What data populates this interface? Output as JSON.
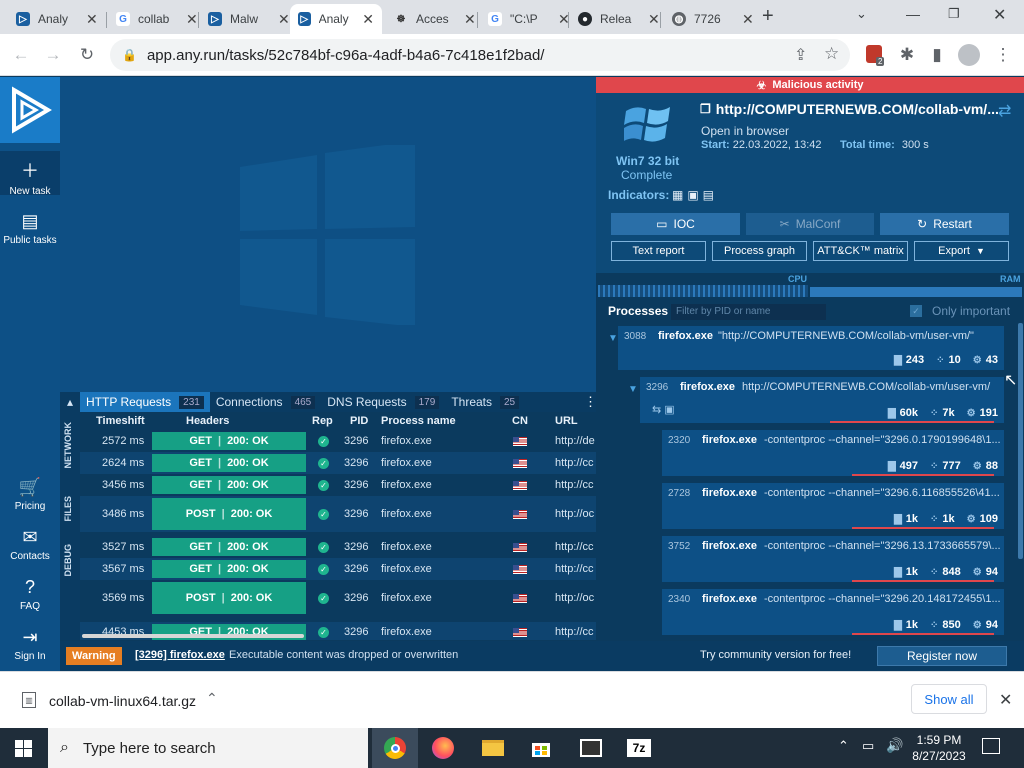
{
  "browser": {
    "tabs": [
      {
        "label": "Analy",
        "icon": "anyrun-icon",
        "active": false
      },
      {
        "label": "collab",
        "icon": "google-icon",
        "active": false
      },
      {
        "label": "Malw",
        "icon": "anyrun-icon",
        "active": false
      },
      {
        "label": "Analy",
        "icon": "anyrun-icon",
        "active": true
      },
      {
        "label": "Acces",
        "icon": "unknown-icon",
        "active": false
      },
      {
        "label": "\"C:\\P",
        "icon": "google-icon",
        "active": false
      },
      {
        "label": "Relea",
        "icon": "github-icon",
        "active": false
      },
      {
        "label": "7726",
        "icon": "globe-icon",
        "active": false
      }
    ],
    "url": "app.any.run/tasks/52c784bf-c96a-4adf-b4a6-7c418e1f2bad/",
    "extension_badge": "2"
  },
  "nav": {
    "new_task": "New task",
    "public_tasks": "Public tasks",
    "pricing": "Pricing",
    "contacts": "Contacts",
    "faq": "FAQ",
    "sign_in": "Sign In"
  },
  "network": {
    "tabs": [
      {
        "label": "HTTP Requests",
        "count": "231"
      },
      {
        "label": "Connections",
        "count": "465"
      },
      {
        "label": "DNS Requests",
        "count": "179"
      },
      {
        "label": "Threats",
        "count": "25"
      }
    ],
    "side_labels": [
      "NETWORK",
      "FILES",
      "DEBUG"
    ],
    "columns": {
      "timeshift": "Timeshift",
      "headers": "Headers",
      "rep": "Rep",
      "pid": "PID",
      "process": "Process name",
      "cn": "CN",
      "url": "URL"
    },
    "rows": [
      {
        "time": "2572 ms",
        "method": "GET",
        "status": "200: OK",
        "pid": "3296",
        "process": "firefox.exe",
        "url": "http://de"
      },
      {
        "time": "2624 ms",
        "method": "GET",
        "status": "200: OK",
        "pid": "3296",
        "process": "firefox.exe",
        "url": "http://cc"
      },
      {
        "time": "3456 ms",
        "method": "GET",
        "status": "200: OK",
        "pid": "3296",
        "process": "firefox.exe",
        "url": "http://cc"
      },
      {
        "time": "3486 ms",
        "method": "POST",
        "status": "200: OK",
        "pid": "3296",
        "process": "firefox.exe",
        "url": "http://oc"
      },
      {
        "time": "3527 ms",
        "method": "GET",
        "status": "200: OK",
        "pid": "3296",
        "process": "firefox.exe",
        "url": "http://cc"
      },
      {
        "time": "3567 ms",
        "method": "GET",
        "status": "200: OK",
        "pid": "3296",
        "process": "firefox.exe",
        "url": "http://cc"
      },
      {
        "time": "3569 ms",
        "method": "POST",
        "status": "200: OK",
        "pid": "3296",
        "process": "firefox.exe",
        "url": "http://oc"
      },
      {
        "time": "4453 ms",
        "method": "GET",
        "status": "200: OK",
        "pid": "3296",
        "process": "firefox.exe",
        "url": "http://cc"
      }
    ]
  },
  "task": {
    "malicious": "Malicious activity",
    "url": "http://COMPUTERNEWB.COM/collab-vm/...",
    "os": "Win7 32 bit",
    "state": "Complete",
    "open_in": "Open in browser",
    "start_label": "Start:",
    "start_value": "22.03.2022, 13:42",
    "total_label": "Total time:",
    "total_value": "300 s",
    "indicators": "Indicators:",
    "ioc": "IOC",
    "malconf": "MalConf",
    "restart": "Restart",
    "text_report": "Text report",
    "process_graph": "Process graph",
    "attck": "ATT&CK™ matrix",
    "export": "Export",
    "cpu": "CPU",
    "ram": "RAM"
  },
  "processes": {
    "title": "Processes",
    "filter_placeholder": "Filter by PID or name",
    "only_important": "Only important",
    "items": [
      {
        "pid": "3088",
        "name": "firefox.exe",
        "cmd": "\"http://COMPUTERNEWB.COM/collab-vm/user-vm/\"",
        "s1": "243",
        "s2": "10",
        "s3": "43"
      },
      {
        "pid": "3296",
        "name": "firefox.exe",
        "cmd": "http://COMPUTERNEWB.COM/collab-vm/user-vm/",
        "s1": "60k",
        "s2": "7k",
        "s3": "191"
      },
      {
        "pid": "2320",
        "name": "firefox.exe",
        "cmd": "-contentproc --channel=\"3296.0.1790199648\\1...",
        "s1": "497",
        "s2": "777",
        "s3": "88"
      },
      {
        "pid": "2728",
        "name": "firefox.exe",
        "cmd": "-contentproc --channel=\"3296.6.116855526\\41...",
        "s1": "1k",
        "s2": "1k",
        "s3": "109"
      },
      {
        "pid": "3752",
        "name": "firefox.exe",
        "cmd": "-contentproc --channel=\"3296.13.1733665579\\...",
        "s1": "1k",
        "s2": "848",
        "s3": "94"
      },
      {
        "pid": "2340",
        "name": "firefox.exe",
        "cmd": "-contentproc --channel=\"3296.20.148172455\\1...",
        "s1": "1k",
        "s2": "850",
        "s3": "94"
      }
    ]
  },
  "notification": {
    "badge": "Warning",
    "process": "[3296] firefox.exe",
    "message": "Executable content was dropped or overwritten",
    "community": "Try community version for free!",
    "register": "Register now"
  },
  "download": {
    "filename": "collab-vm-linux64.tar.gz",
    "show_all": "Show all"
  },
  "taskbar": {
    "search_placeholder": "Type here to search",
    "time": "1:59 PM",
    "date": "8/27/2023"
  }
}
